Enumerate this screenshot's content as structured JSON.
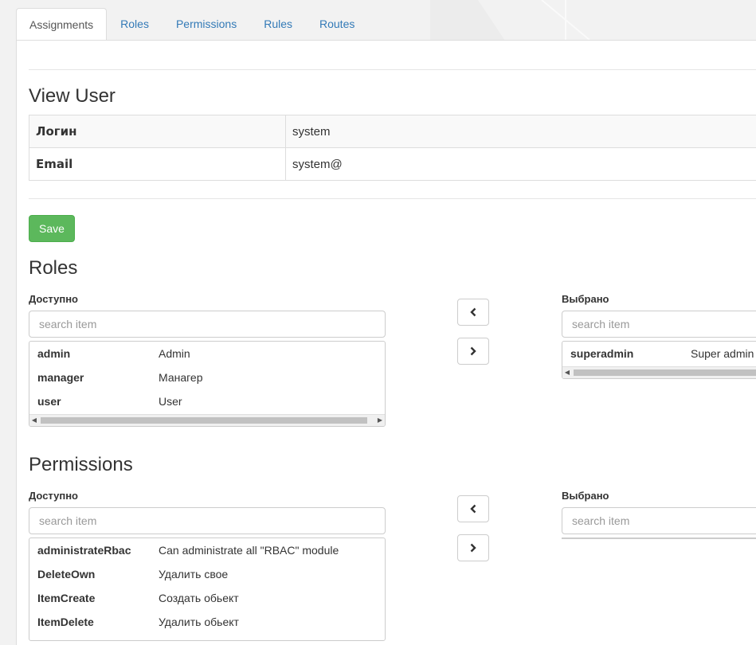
{
  "tabs": [
    {
      "label": "Assignments",
      "active": true
    },
    {
      "label": "Roles"
    },
    {
      "label": "Permissions"
    },
    {
      "label": "Rules"
    },
    {
      "label": "Routes"
    }
  ],
  "view": {
    "title": "View User",
    "rows": [
      {
        "label": "Логин",
        "value": "system"
      },
      {
        "label": "Email",
        "value": "system@"
      }
    ]
  },
  "save_label": "Save",
  "roles": {
    "title": "Roles",
    "available_label": "Доступно",
    "selected_label": "Выбрано",
    "search_placeholder": "search item",
    "available": [
      {
        "name": "admin",
        "desc": "Admin"
      },
      {
        "name": "manager",
        "desc": "Манагер"
      },
      {
        "name": "user",
        "desc": "User"
      }
    ],
    "selected": [
      {
        "name": "superadmin",
        "desc": "Super admin"
      }
    ]
  },
  "permissions": {
    "title": "Permissions",
    "available_label": "Доступно",
    "selected_label": "Выбрано",
    "search_placeholder": "search item",
    "available": [
      {
        "name": "administrateRbac",
        "desc": "Can administrate all \"RBAC\" module"
      },
      {
        "name": "DeleteOwn",
        "desc": "Удалить свое"
      },
      {
        "name": "ItemCreate",
        "desc": "Создать обьект"
      },
      {
        "name": "ItemDelete",
        "desc": "Удалить обьект"
      }
    ]
  },
  "colors": {
    "link": "#337ab7",
    "success": "#5cb85c"
  }
}
